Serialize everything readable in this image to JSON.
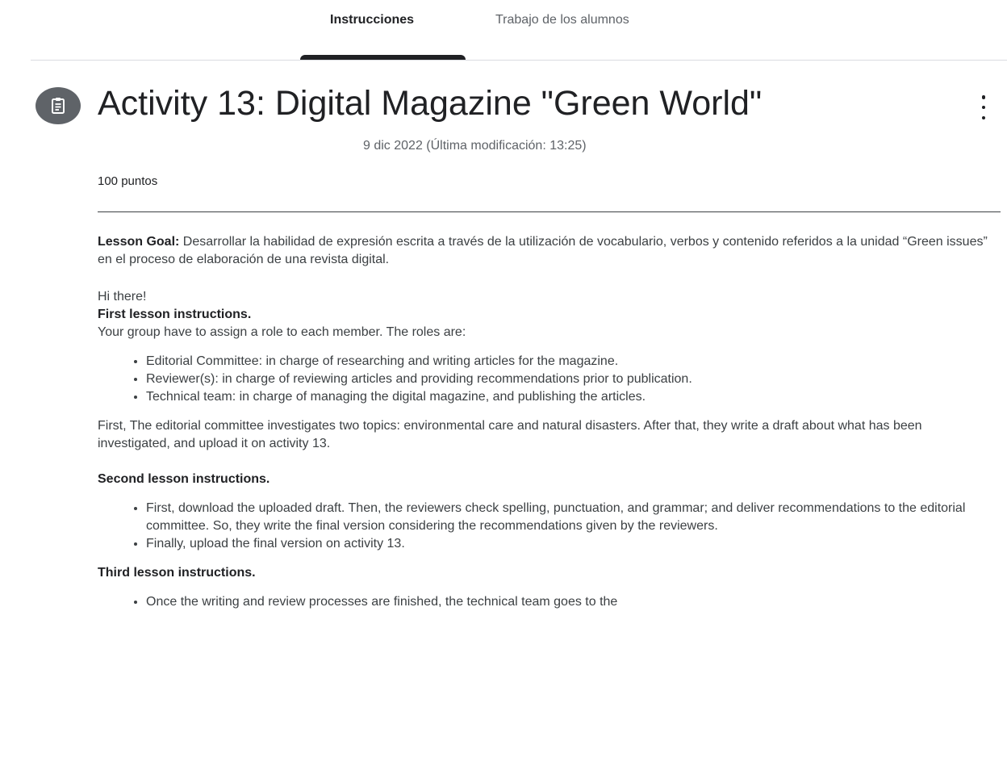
{
  "tabs": {
    "instructions": "Instrucciones",
    "student_work": "Trabajo de los alumnos"
  },
  "assignment": {
    "title": "Activity 13: Digital Magazine \"Green World\"",
    "date": "9 dic 2022 (Última modificación: 13:25)",
    "points": "100 puntos"
  },
  "body": {
    "lesson_goal_label": "Lesson Goal:",
    "lesson_goal_text": " Desarrollar la habilidad de expresión escrita a través de la utilización de vocabulario, verbos y contenido referidos a la unidad “Green issues” en el proceso de elaboración de una revista digital.",
    "greeting": "Hi there!",
    "first_heading": "First lesson instructions.",
    "first_intro": "Your group have to assign a role to each member. The roles are:",
    "roles": [
      "Editorial Committee: in charge of researching and writing articles for the magazine.",
      "Reviewer(s): in charge of reviewing articles and providing recommendations prior to publication.",
      "Technical team: in charge of managing the digital magazine, and publishing the articles."
    ],
    "first_paragraph": "First, The editorial committee investigates two topics: environmental care and natural disasters. After that, they write a draft about what has been investigated, and upload it on activity 13.",
    "second_heading": "Second lesson instructions.",
    "second_items": [
      "First, download the uploaded draft. Then, the reviewers check spelling, punctuation, and grammar; and deliver recommendations to the editorial committee. So, they write the final version considering the recommendations given by the reviewers.",
      "Finally, upload the final version on activity 13."
    ],
    "third_heading": "Third lesson instructions.",
    "third_items": [
      "Once the writing and review processes are finished, the technical team goes to the"
    ]
  }
}
